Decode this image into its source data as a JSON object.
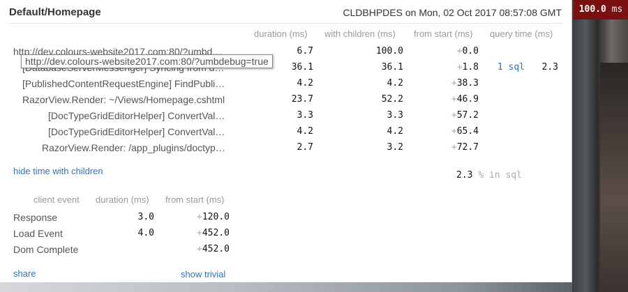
{
  "badge": {
    "value": "100.0",
    "unit": "ms"
  },
  "page": {
    "title": "Default/Homepage",
    "machine_info": "CLDBHPDES on Mon, 02 Oct 2017 08:57:08 GMT"
  },
  "timings": {
    "headers": {
      "duration": "duration (ms)",
      "with_children": "with children (ms)",
      "from_start": "from start (ms)",
      "query_time": "query time (ms)"
    },
    "rows": [
      {
        "name": "http://dev.colours-website2017.com:80/?umbd…",
        "duration": "6.7",
        "with_children": "100.0",
        "from_start": "0.0",
        "queries": "",
        "query_time": ""
      },
      {
        "name": "[DatabaseServerMessenger] Syncing from d…",
        "duration": "36.1",
        "with_children": "36.1",
        "from_start": "1.8",
        "queries": "1 sql",
        "query_time": "2.3"
      },
      {
        "name": "[PublishedContentRequestEngine] FindPubli…",
        "duration": "4.2",
        "with_children": "4.2",
        "from_start": "38.3",
        "queries": "",
        "query_time": ""
      },
      {
        "name": "RazorView.Render: ~/Views/Homepage.cshtml",
        "duration": "23.7",
        "with_children": "52.2",
        "from_start": "46.9",
        "queries": "",
        "query_time": ""
      },
      {
        "name": "[DocTypeGridEditorHelper] ConvertVal…",
        "duration": "3.3",
        "with_children": "3.3",
        "from_start": "57.2",
        "queries": "",
        "query_time": ""
      },
      {
        "name": "[DocTypeGridEditorHelper] ConvertVal…",
        "duration": "4.2",
        "with_children": "4.2",
        "from_start": "65.4",
        "queries": "",
        "query_time": ""
      },
      {
        "name": "RazorView.Render: /app_plugins/doctyp…",
        "duration": "2.7",
        "with_children": "3.2",
        "from_start": "72.7",
        "queries": "",
        "query_time": ""
      }
    ],
    "toggle_link": "hide time with children",
    "sql_percent": "2.3",
    "sql_percent_label": "% in sql"
  },
  "tooltip": {
    "text": "http://dev.colours-website2017.com:80/?umbdebug=true"
  },
  "client_timings": {
    "headers": {
      "event": "client event",
      "duration": "duration (ms)",
      "from_start": "from start (ms)"
    },
    "rows": [
      {
        "event": "Response",
        "duration": "3.0",
        "from_start": "120.0"
      },
      {
        "event": "Load Event",
        "duration": "4.0",
        "from_start": "452.0"
      },
      {
        "event": "Dom Complete",
        "duration": "",
        "from_start": "452.0"
      }
    ]
  },
  "footer": {
    "share_label": "share",
    "show_trivial_label": "show trivial"
  },
  "plus_sign": "+"
}
